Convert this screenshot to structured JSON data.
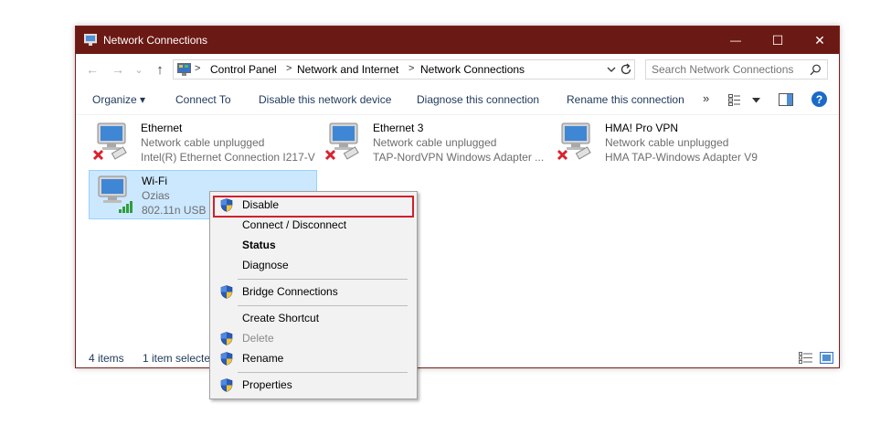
{
  "window": {
    "title": "Network Connections",
    "minimize_glyph": "—",
    "maximize_glyph": "☐",
    "close_glyph": "✕"
  },
  "nav": {
    "back_glyph": "←",
    "forward_glyph": "→",
    "recent_glyph": "⌄",
    "up_glyph": "↑"
  },
  "address": {
    "crumbs": [
      "Control Panel",
      "Network and Internet",
      "Network Connections"
    ],
    "separator": ">"
  },
  "search": {
    "placeholder": "Search Network Connections"
  },
  "toolbar": {
    "organize": "Organize ▾",
    "connect_to": "Connect To",
    "disable_device": "Disable this network device",
    "diagnose": "Diagnose this connection",
    "rename": "Rename this connection",
    "more": "»",
    "help": "?"
  },
  "items": [
    {
      "name": "Ethernet",
      "status": "Network cable unplugged",
      "device": "Intel(R) Ethernet Connection I217-V",
      "state": "unplugged"
    },
    {
      "name": "Ethernet 3",
      "status": "Network cable unplugged",
      "device": "TAP-NordVPN Windows Adapter ...",
      "state": "unplugged"
    },
    {
      "name": "HMA! Pro VPN",
      "status": "Network cable unplugged",
      "device": "HMA TAP-Windows Adapter V9",
      "state": "unplugged"
    },
    {
      "name": "Wi-Fi",
      "status": "Ozias",
      "device": "802.11n USB W",
      "state": "connected"
    }
  ],
  "statusbar": {
    "count": "4 items",
    "selected": "1 item selecte"
  },
  "context_menu": {
    "items": [
      {
        "label": "Disable",
        "shield": true
      },
      {
        "label": "Connect / Disconnect",
        "shield": false
      },
      {
        "label": "Status",
        "shield": false,
        "bold": true
      },
      {
        "label": "Diagnose",
        "shield": false
      },
      {
        "label": "Bridge Connections",
        "shield": true
      },
      {
        "label": "Create Shortcut",
        "shield": false
      },
      {
        "label": "Delete",
        "shield": true,
        "disabled": true
      },
      {
        "label": "Rename",
        "shield": true
      },
      {
        "label": "Properties",
        "shield": true
      }
    ]
  },
  "colors": {
    "titlebar": "#6b1914",
    "selection": "#cce8ff",
    "highlight": "#d21f2d",
    "command_text": "#1e395b"
  }
}
